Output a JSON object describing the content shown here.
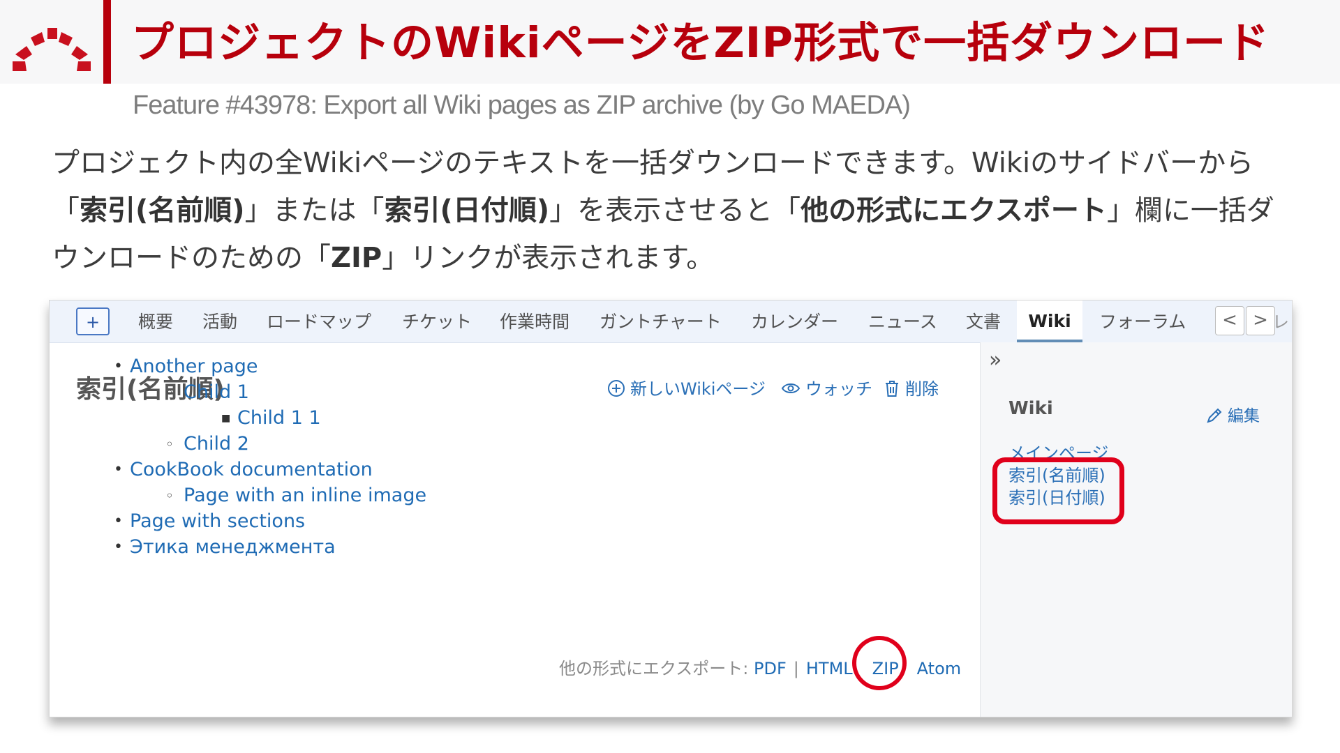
{
  "slide": {
    "title": "プロジェクトのWikiページをZIP形式で一括ダウンロード",
    "subtitle": "Feature #43978: Export all Wiki pages as ZIP archive (by Go MAEDA)",
    "description": {
      "p1": "プロジェクト内の全Wikiページのテキストを一括ダウンロードできます。Wikiのサイドバーから「",
      "b1": "索引(名前順)",
      "p2": "」または「",
      "b2": "索引(日付順)",
      "p3": "」を表示させると「",
      "b3": "他の形式にエクスポート",
      "p4": "」欄に一括ダウンロードのための「",
      "b4": "ZIP",
      "p5": "」リンクが表示されます。"
    },
    "colors": {
      "accent": "#b7000c",
      "annotation": "#e0001b",
      "link": "#1f6bb4"
    }
  },
  "menu": {
    "new_label": "+",
    "tabs": [
      "概要",
      "活動",
      "ロードマップ",
      "チケット",
      "作業時間",
      "ガントチャート",
      "カレンダー",
      "ニュース",
      "文書",
      "Wiki",
      "フォーラム"
    ],
    "selected": "Wiki",
    "prev_label": "<",
    "next_label": ">",
    "overflow_label": "レ"
  },
  "content": {
    "title": "索引(名前順)",
    "actions": {
      "new_page": "新しいWikiページ",
      "watch": "ウォッチ",
      "delete": "削除"
    },
    "pages": [
      {
        "label": "Another page",
        "level": 0
      },
      {
        "label": "Child 1",
        "level": 1
      },
      {
        "label": "Child 1 1",
        "level": 2
      },
      {
        "label": "Child 2",
        "level": 1
      },
      {
        "label": "CookBook documentation",
        "level": 0
      },
      {
        "label": "Page with an inline image",
        "level": 1
      },
      {
        "label": "Page with sections",
        "level": 0
      },
      {
        "label": "Этика менеджмента",
        "level": 0
      }
    ],
    "export": {
      "label": "他の形式にエクスポート:",
      "pdf": "PDF",
      "html": "HTML",
      "zip": "ZIP",
      "atom": "Atom",
      "separator": "|"
    }
  },
  "sidebar": {
    "toggle": "»",
    "heading": "Wiki",
    "edit_label": "編集",
    "links": [
      "メインページ",
      "索引(名前順)",
      "索引(日付順)"
    ]
  }
}
